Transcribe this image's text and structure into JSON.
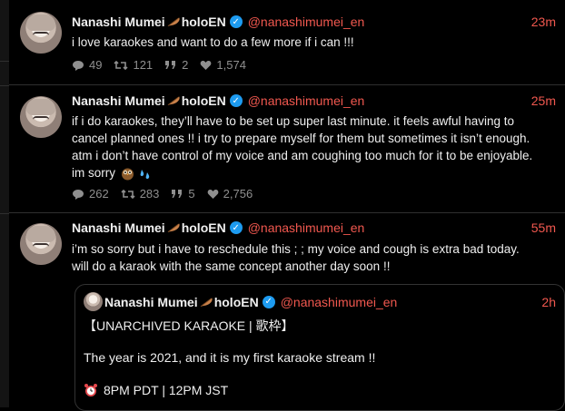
{
  "author": {
    "name": "Nanashi Mumei",
    "org": "holoEN",
    "handle": "@nanashimumei_en"
  },
  "tweets": [
    {
      "time": "23m",
      "text": "i love karaokes and want to do a few more if i can !!!",
      "replies": "49",
      "retweets": "121",
      "quotes": "2",
      "likes": "1,574"
    },
    {
      "time": "25m",
      "lines": [
        "if i do karaokes, they’ll have to be set up super last minute. it feels awful having to",
        "cancel planned ones !! i try to prepare myself for them but sometimes it isn’t enough.",
        "atm i don’t have control of my voice and am coughing too much for it to be enjoyable.",
        "im sorry"
      ],
      "replies": "262",
      "retweets": "283",
      "quotes": "5",
      "likes": "2,756"
    },
    {
      "time": "55m",
      "lines": [
        "i’m so sorry but i have to reschedule this ; ; my voice and cough is extra bad today.",
        "will do a karaok with the same concept another day soon !!"
      ],
      "quote": {
        "time": "2h",
        "title": "【UNARCHIVED KARAOKE | 歌枠】",
        "body": "The year is 2021, and it is my first karaoke stream !!",
        "schedule": "8PM PDT | 12PM JST"
      }
    }
  ],
  "colors": {
    "accent": "#f1584f",
    "verified": "#1d9bf0",
    "muted": "#8f8f8f",
    "background": "#000000"
  },
  "icons": [
    "feather-icon",
    "verified-icon",
    "reply-icon",
    "retweet-icon",
    "quote-icon",
    "heart-icon",
    "owl-emoji-icon",
    "sweat-drops-icon",
    "alarm-clock-icon"
  ]
}
